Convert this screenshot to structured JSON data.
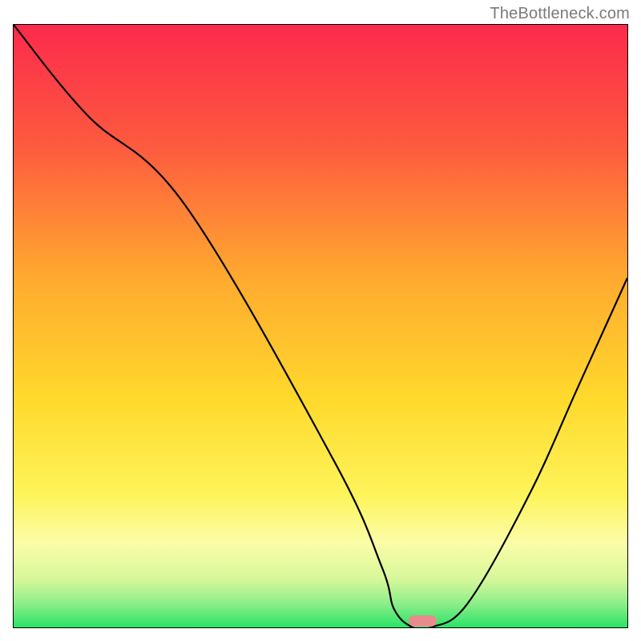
{
  "watermark": "TheBottleneck.com",
  "colors": {
    "top": "#fc2a4c",
    "mid1": "#fd8b3c",
    "mid2": "#ffd22c",
    "mid3": "#fdf45a",
    "band_pale": "#fbfda8",
    "band_green_light": "#b7f58e",
    "band_green": "#2be368",
    "curve": "#000000",
    "marker": "#e98b8e",
    "border": "#000000"
  },
  "chart_data": {
    "type": "line",
    "title": "",
    "xlabel": "",
    "ylabel": "",
    "xlim": [
      0,
      100
    ],
    "ylim": [
      0,
      100
    ],
    "series": [
      {
        "name": "bottleneck-curve",
        "x": [
          0,
          12,
          28,
          52,
          60,
          62,
          65,
          68,
          74,
          84,
          92,
          100
        ],
        "values": [
          100,
          85,
          70,
          28,
          10,
          3,
          0,
          0,
          4,
          22,
          40,
          58
        ]
      }
    ],
    "optimum_marker": {
      "x": 66.5,
      "y": 0,
      "width_pct": 4.5
    },
    "background_gradient_stops": [
      {
        "pct": 0,
        "color": "#fc2a4c"
      },
      {
        "pct": 20,
        "color": "#fd5a3f"
      },
      {
        "pct": 42,
        "color": "#ffaa2f"
      },
      {
        "pct": 62,
        "color": "#ffd92c"
      },
      {
        "pct": 78,
        "color": "#fdf45a"
      },
      {
        "pct": 86,
        "color": "#fbfda8"
      },
      {
        "pct": 92,
        "color": "#d7f79a"
      },
      {
        "pct": 96,
        "color": "#8eee8a"
      },
      {
        "pct": 100,
        "color": "#2be368"
      }
    ]
  }
}
